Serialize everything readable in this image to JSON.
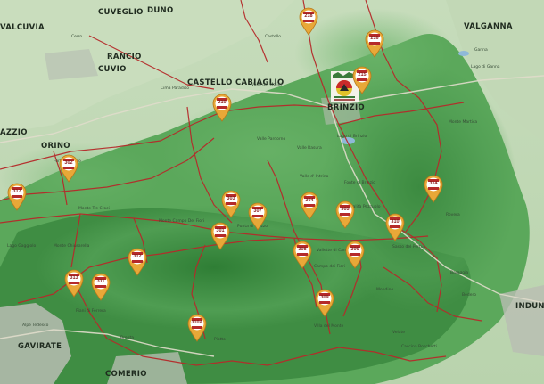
{
  "map": {
    "colors": {
      "trail": "#b52a2a",
      "road": "#c04040",
      "forest_dark": "#3d8a40",
      "forest_mid": "#5aa55a",
      "valley": "#a9cc9a",
      "urban": "#b9b9b9",
      "pin_fill": "#e8a838",
      "pin_badge": "#ffffff",
      "pin_number": "#8a1c1c"
    },
    "places_big": [
      "CASTELLO CABIAGLIO",
      "ORINO",
      "BRINZIO",
      "VALGANNA",
      "GAVIRATE",
      "COMERIO",
      "INDUNO",
      "AZZIO",
      "CUVIO",
      "CUVEGLIO",
      "VALCUVIA",
      "DUNO",
      "RANCIO"
    ],
    "places_small": [
      "Valle dei Molini",
      "Valle Pardorno",
      "Valle Rasura",
      "Valle d' Intrino",
      "Monte Campo Dei Fiori",
      "Punta di Mezzo",
      "Monte Martica",
      "Lago di Brinzio",
      "Ganna",
      "Località Pezzuolo",
      "Sasso del Pertus",
      "Vallette di Campo",
      "Cima Paradiso",
      "Campo dei Fiori",
      "Forte di Orino",
      "Monte Tre Croci",
      "Fonte di Brinzio",
      "Baraggia",
      "Monte Chiusarella",
      "Piani di Ferrera",
      "Velate",
      "Bedero",
      "Cerro",
      "Brenta",
      "Mondino",
      "Castello",
      "Lago di Ganna",
      "Alpe Tedesco",
      "Cascina Boschetti",
      "Rovera",
      "Piatto",
      "Villa del Monte",
      "Lago Gaggiolo"
    ],
    "pins": [
      "218",
      "216",
      "215",
      "210",
      "302",
      "317",
      "314",
      "303",
      "307",
      "304",
      "305",
      "310",
      "301",
      "312",
      "308",
      "306",
      "313",
      "311",
      "309",
      "310A"
    ],
    "logo_icon": "park-logo-icon"
  }
}
